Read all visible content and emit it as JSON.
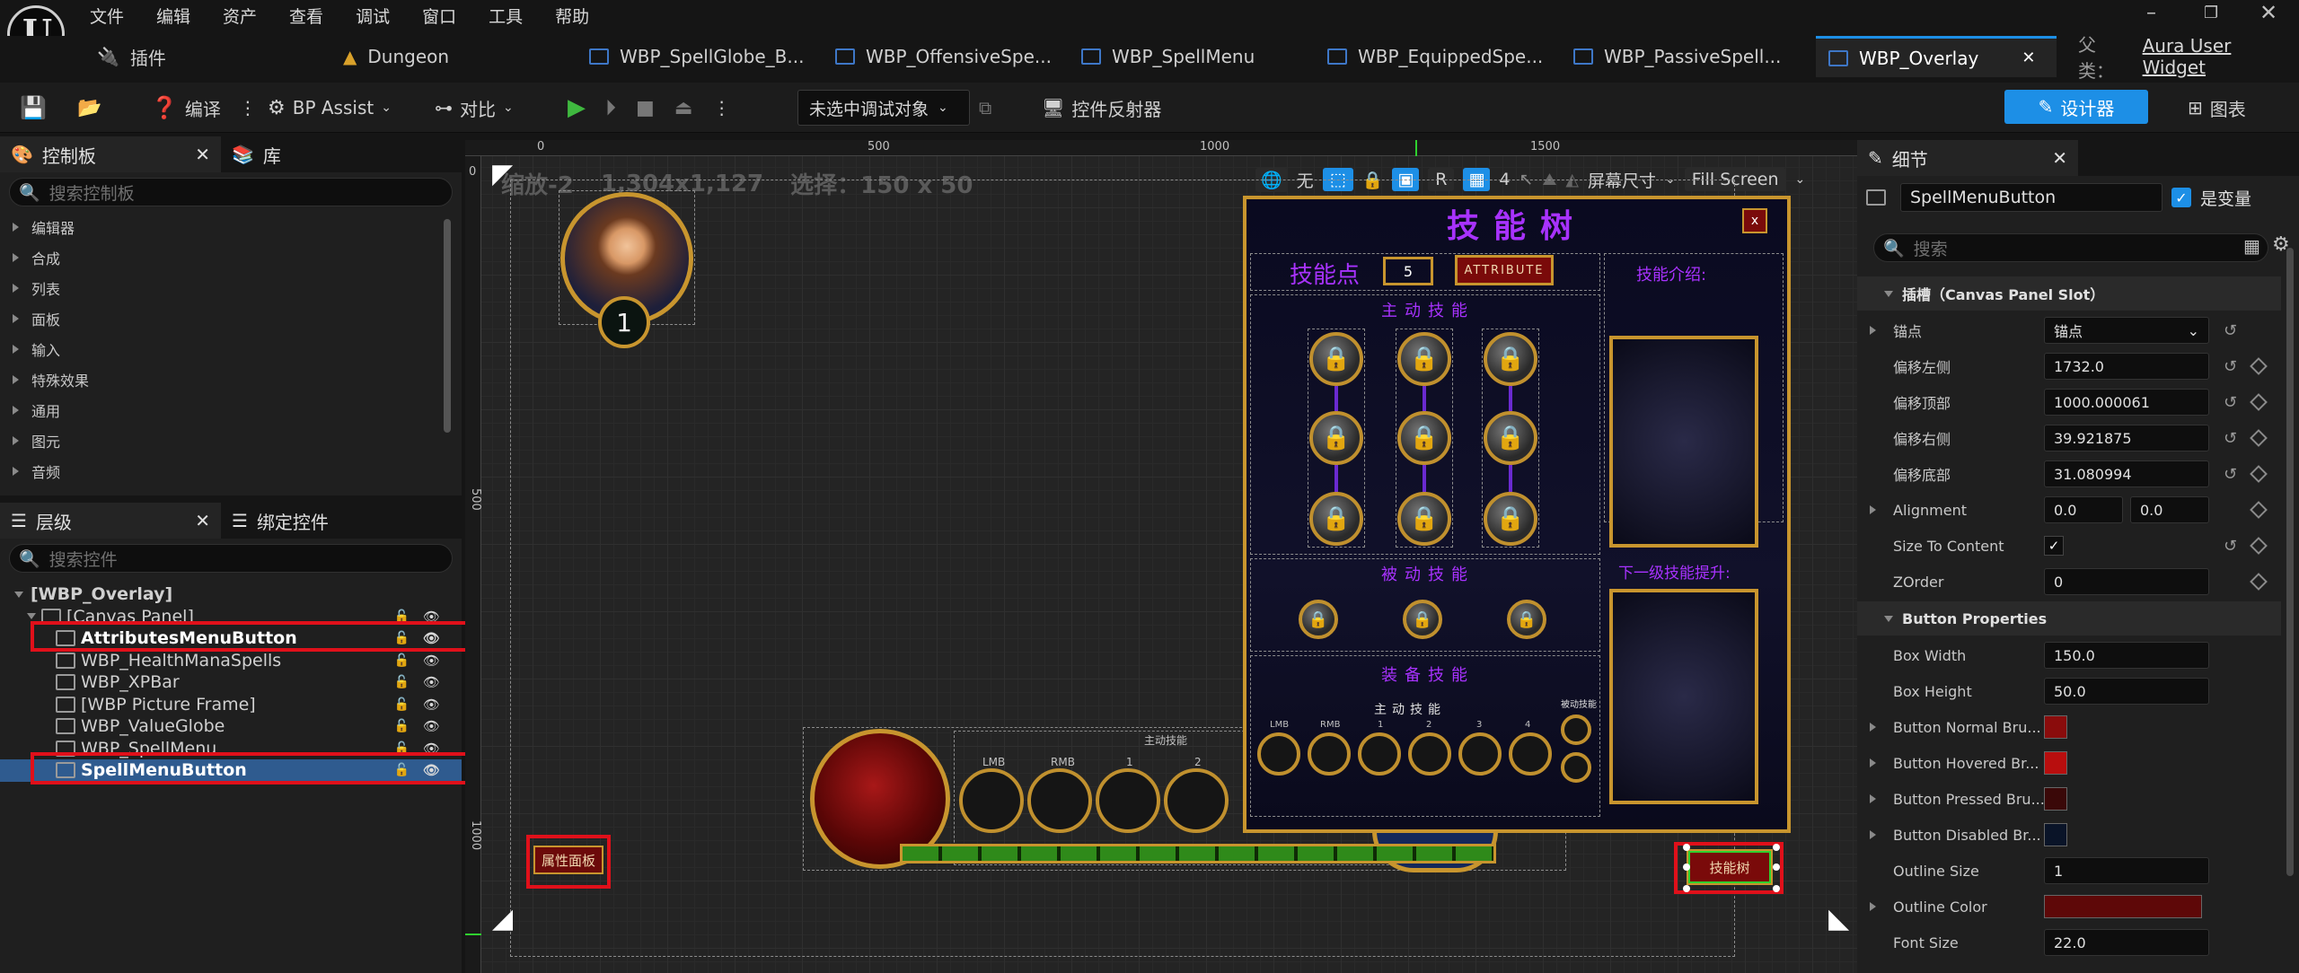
{
  "menu": [
    "文件",
    "编辑",
    "资产",
    "查看",
    "调试",
    "窗口",
    "工具",
    "帮助"
  ],
  "tabs": {
    "plugins": "插件",
    "items": [
      "Dungeon",
      "WBP_SpellGlobe_B...",
      "WBP_OffensiveSpe...",
      "WBP_SpellMenu",
      "WBP_EquippedSpe...",
      "WBP_PassiveSpell...",
      "WBP_Overlay"
    ],
    "parent_label": "父类：",
    "parent_value": "Aura User Widget"
  },
  "toolbar": {
    "compile": "编译",
    "bp_assist": "BP Assist",
    "diff": "对比",
    "debug_target": "未选中调试对象",
    "widget_reflector": "控件反射器",
    "designer": "设计器",
    "graph": "图表"
  },
  "palette": {
    "title": "控制板",
    "library": "库",
    "search_placeholder": "搜索控制板",
    "categories": [
      "编辑器",
      "合成",
      "列表",
      "面板",
      "输入",
      "特殊效果",
      "通用",
      "图元",
      "音频"
    ]
  },
  "hierarchy": {
    "title": "层级",
    "bind_tab": "绑定控件",
    "search_placeholder": "搜索控件",
    "items": [
      "[WBP_Overlay]",
      "[Canvas Panel]",
      "AttributesMenuButton",
      "WBP_HealthManaSpells",
      "WBP_XPBar",
      "[WBP Picture Frame]",
      "WBP_ValueGlobe",
      "WBP_SpellMenu",
      "SpellMenuButton"
    ]
  },
  "canvas": {
    "zoom_info": "缩放-2",
    "size_info": "1,304x1,127",
    "selection_info": "选择：150 x 50",
    "ruler_marks": [
      "0",
      "500",
      "1000",
      "1500"
    ],
    "vruler_marks": [
      "0",
      "500",
      "1000"
    ],
    "toolbar_none": "无",
    "toolbar_r": "R",
    "toolbar_grid": "4",
    "screen_size": "屏幕尺寸",
    "fill_screen": "Fill Screen"
  },
  "spell_menu": {
    "title": "技能树",
    "close": "x",
    "points_label": "技能点",
    "points_value": "5",
    "attribute_btn": "ATTRIBUTE",
    "desc_label": "技能介绍:",
    "offensive_label": "主动技能",
    "passive_label": "被动技能",
    "equipped_label": "装备技能",
    "next_level_label": "下一级技能提升:",
    "equipped_sub": "主动技能",
    "equipped_passive": "被动技能",
    "slot_labels": [
      "LMB",
      "RMB",
      "1",
      "2",
      "3",
      "4"
    ]
  },
  "hud": {
    "level": "1",
    "attributes_button": "属性面板",
    "spell_button": "技能树",
    "globe_slots": [
      "LMB",
      "RMB",
      "1",
      "2"
    ],
    "globe_header": "主动技能"
  },
  "details": {
    "title": "细节",
    "widget_name": "SpellMenuButton",
    "is_variable": "是变量",
    "search_placeholder": "搜索",
    "slot_section": "插槽（Canvas Panel Slot）",
    "rows": [
      {
        "label": "锚点",
        "value": "锚点"
      },
      {
        "label": "偏移左侧",
        "value": "1732.0"
      },
      {
        "label": "偏移顶部",
        "value": "1000.000061"
      },
      {
        "label": "偏移右侧",
        "value": "39.921875"
      },
      {
        "label": "偏移底部",
        "value": "31.080994"
      },
      {
        "label": "Alignment",
        "value": "0.0",
        "value2": "0.0"
      },
      {
        "label": "Size To Content",
        "value": ""
      },
      {
        "label": "ZOrder",
        "value": "0"
      }
    ],
    "button_section": "Button Properties",
    "brows": [
      {
        "label": "Box Width",
        "value": "150.0"
      },
      {
        "label": "Box Height",
        "value": "50.0"
      },
      {
        "label": "Button Normal Bru...",
        "color": "#8a0c0c"
      },
      {
        "label": "Button Hovered Br...",
        "color": "#b80e0e"
      },
      {
        "label": "Button Pressed Bru...",
        "color": "#3a0808"
      },
      {
        "label": "Button Disabled Br...",
        "color": "#0a1428"
      },
      {
        "label": "Outline Size",
        "value": "1"
      },
      {
        "label": "Outline Color",
        "color": "#5e0808"
      },
      {
        "label": "Font Size",
        "value": "22.0"
      }
    ]
  },
  "colors": {
    "accent": "#1d8fe6",
    "gold": "#c8952e",
    "purple": "#a832ff",
    "selection_red": "#e0101a"
  }
}
